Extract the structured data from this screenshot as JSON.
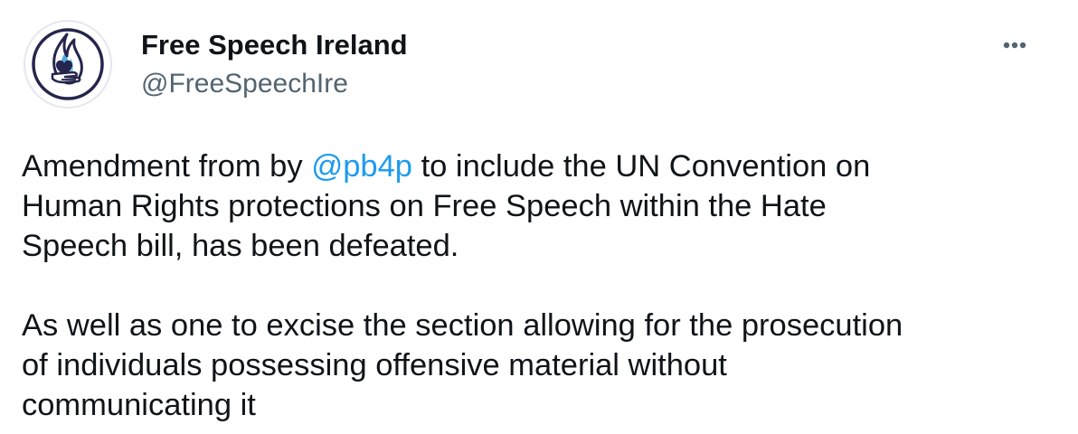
{
  "author": {
    "display_name": "Free Speech Ireland",
    "handle": "@FreeSpeechIre",
    "avatar_icon": "flame-hand-logo-icon"
  },
  "menu": {
    "more_icon": "more-options-icon"
  },
  "tweet": {
    "paragraph1": {
      "line1_before": "Amendment from by ",
      "mention": "@pb4p",
      "line1_after": " to include the UN Convention on",
      "line2": "Human Rights protections on Free Speech within the Hate",
      "line3": "Speech bill, has been defeated."
    },
    "paragraph2": {
      "line1": "As well as one to excise the section allowing for the prosecution",
      "line2": "of individuals possessing offensive material without",
      "line3": "communicating it"
    }
  },
  "colors": {
    "text": "#0f1419",
    "secondary": "#536471",
    "link": "#1d9bf0",
    "logo_ring": "#25254d"
  }
}
